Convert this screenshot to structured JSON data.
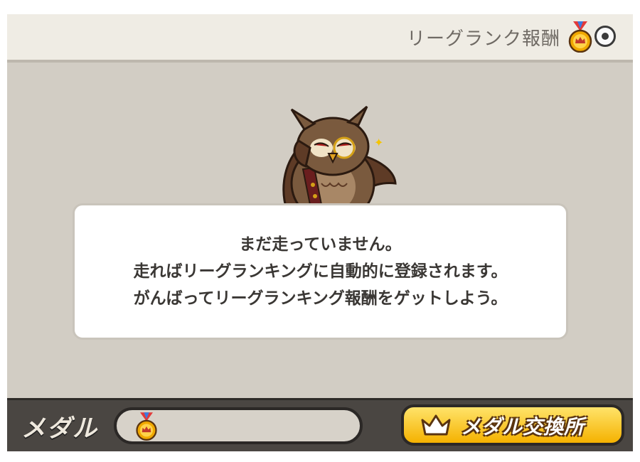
{
  "header": {
    "title": "リーグランク報酬",
    "medal_icon": "medal-icon",
    "info_icon": "info-icon"
  },
  "main": {
    "mascot": "owl-mascot",
    "message_lines": [
      "まだ走っていません。",
      "走ればリーグランキングに自動的に登録されます。",
      "がんばってリーグランキング報酬をゲットしよう。"
    ]
  },
  "footer": {
    "medal_label": "メダル",
    "medal_count": "",
    "exchange_label": "メダル交換所",
    "exchange_icon": "crown-icon"
  },
  "colors": {
    "header_bg": "#efece4",
    "main_bg": "#d2cdc4",
    "footer_bg": "#4a4642",
    "button_yellow": "#f5b200"
  }
}
